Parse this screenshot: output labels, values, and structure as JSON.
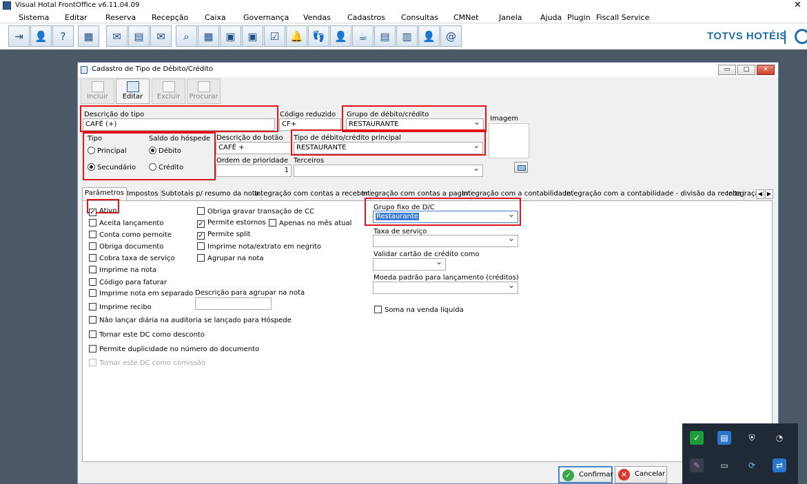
{
  "app": {
    "title": "Visual Hotal FrontOffice v6.11.04.09",
    "brand": "TOTVS HOTÉIS"
  },
  "menu": [
    "Sistema",
    "Editar",
    "Reserva",
    "Recepção",
    "Caixa",
    "Governança",
    "Vendas",
    "Cadastros",
    "Consultas",
    "CMNet",
    "Janela",
    "Ajuda",
    "Plugin",
    "Fiscall Service"
  ],
  "toolbar_icons": [
    "exit-icon",
    "users-icon",
    "help-icon",
    "org-chart-icon",
    "mail-icon",
    "form-icon",
    "mail-forward-icon",
    "search-icon",
    "calendar-grid-icon",
    "guest-card-icon",
    "guest-list-icon",
    "checklist-icon",
    "bell-icon",
    "footprints-icon",
    "add-guest-icon",
    "room-service-icon",
    "cashier-icon",
    "housekeeper-icon",
    "email-at-icon"
  ],
  "dialog": {
    "title": "Cadastro de Tipo de Débito/Crédito",
    "actions": {
      "incluir": "Incluir",
      "editar": "Editar",
      "excluir": "Excluir",
      "procurar": "Procurar"
    },
    "fields": {
      "descricao_tipo_label": "Descrição do tipo",
      "descricao_tipo_value": "CAFÉ (+)",
      "codigo_reduzido_label": "Código reduzido",
      "codigo_reduzido_value": "CF+",
      "grupo_label": "Grupo de débito/crédito",
      "grupo_value": "RESTAURANTE",
      "imagem_label": "Imagem",
      "tipo_label": "Tipo",
      "tipo_principal": "Principal",
      "tipo_secundario": "Secundário",
      "saldo_label": "Saldo do hóspede",
      "saldo_debito": "Débito",
      "saldo_credito": "Crédito",
      "descricao_botao_label": "Descrição do botão",
      "descricao_botao_value": "CAFÉ +",
      "tipo_principal_label": "Tipo de débito/crédito principal",
      "tipo_principal_value": "RESTAURANTE",
      "ordem_label": "Ordem de prioridade",
      "ordem_value": "1",
      "terceiros_label": "Terceiros",
      "terceiros_value": ""
    },
    "tabs": [
      "Parâmetros",
      "Impostos",
      "Subtotais p/ resumo da nota",
      "Integração com contas a receber",
      "Integração com contas a pagar",
      "Integração com a contabilidade",
      "Integração com a contabilidade - divisão da receita",
      "Integraçã"
    ],
    "params_col1": [
      {
        "label": "Ativo",
        "checked": true,
        "enabled": true
      },
      {
        "label": "Aceita lançamento",
        "checked": false,
        "enabled": true
      },
      {
        "label": "Conta como pernoite",
        "checked": false,
        "enabled": true
      },
      {
        "label": "Obriga documento",
        "checked": false,
        "enabled": true
      },
      {
        "label": "Cobra taxa de serviço",
        "checked": false,
        "enabled": true
      },
      {
        "label": "Imprime na nota",
        "checked": false,
        "enabled": true
      },
      {
        "label": "Código para faturar",
        "checked": false,
        "enabled": true
      },
      {
        "label": "Imprime nota em separado",
        "checked": false,
        "enabled": true
      },
      {
        "label": "Imprime recibo",
        "checked": false,
        "enabled": true
      },
      {
        "label": "Não lançar diária na auditoria se lançado para Hóspede",
        "checked": false,
        "enabled": true
      },
      {
        "label": "Tornar este DC como desconto",
        "checked": false,
        "enabled": true
      },
      {
        "label": "Permite duplicidade no número do documento",
        "checked": false,
        "enabled": true
      },
      {
        "label": "Tornar este DC como comissão",
        "checked": false,
        "enabled": false
      }
    ],
    "params_col2": [
      {
        "label": "Obriga gravar transação de CC",
        "checked": false
      },
      {
        "label": "Permite estornos",
        "checked": true
      },
      {
        "label": "Apenas no mês atual",
        "checked": false
      },
      {
        "label": "Permite split",
        "checked": true
      },
      {
        "label": "Imprime nota/extrato em negrito",
        "checked": false
      },
      {
        "label": "Agrupar na nota",
        "checked": false
      }
    ],
    "agrupar_desc_label": "Descrição para agrupar na nota",
    "agrupar_desc_value": "",
    "col3": {
      "grupo_fixo_label": "Grupo fixo de D/C",
      "grupo_fixo_value": "Restaurante",
      "taxa_servico_label": "Taxa de serviço",
      "validar_cartao_label": "Validar cartão de crédito como",
      "moeda_label": "Moeda padrão para lançamento (créditos)",
      "soma_label": "Soma na venda líquida"
    },
    "buttons": {
      "confirmar": "Confirmar",
      "cancelar": "Cancelar"
    }
  },
  "colors": {
    "highlight": "#e0141b",
    "brand": "#1f6ea7",
    "selection": "#3b7bd6"
  },
  "tray_icons": [
    "defender-shield-icon",
    "network-monitor-icon",
    "security-shield-icon",
    "satellite-dish-icon",
    "pen-icon",
    "drive-check-icon",
    "sync-icon",
    "remote-connect-icon"
  ]
}
